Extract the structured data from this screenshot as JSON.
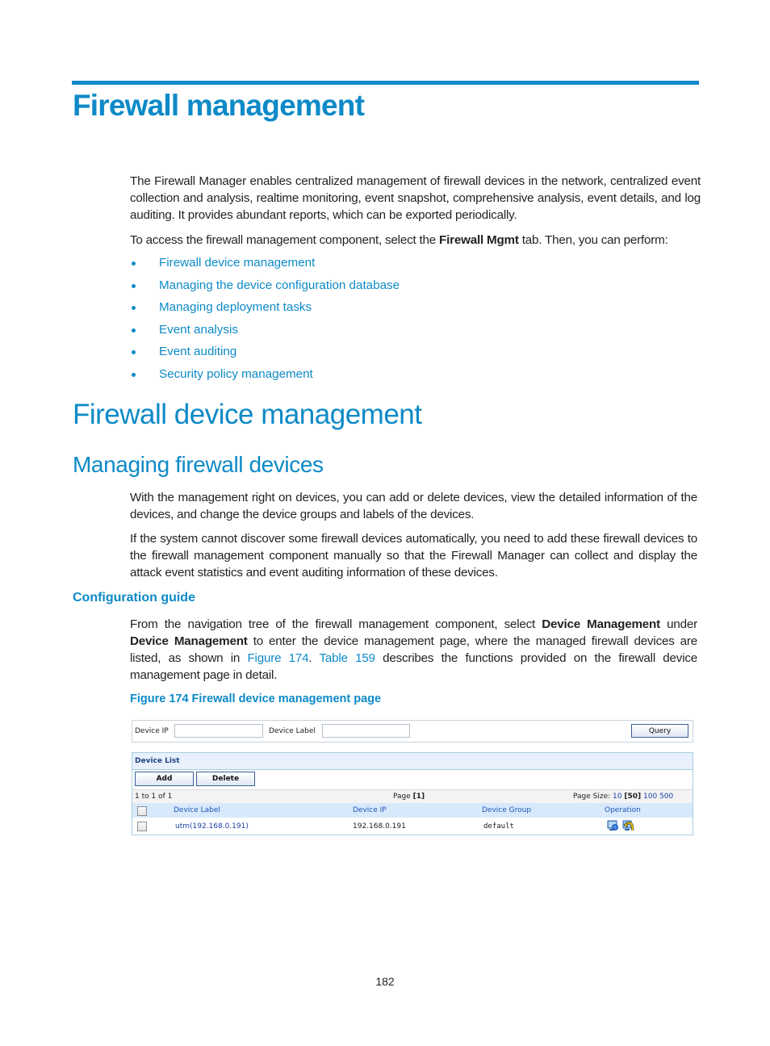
{
  "heading1": "Firewall management",
  "intro": {
    "para1": "The Firewall Manager enables centralized management of firewall devices in the network, centralized event collection and analysis, realtime monitoring, event snapshot, comprehensive analysis, event details, and log auditing. It provides abundant reports, which can be exported periodically.",
    "para2_before": "To access the firewall management component, select the ",
    "para2_bold": "Firewall Mgmt",
    "para2_after": " tab. Then, you can perform:"
  },
  "bullets": [
    "Firewall device management",
    "Managing the device configuration database",
    "Managing deployment tasks",
    "Event analysis",
    "Event auditing",
    "Security policy management"
  ],
  "heading2": "Firewall device management",
  "heading3": "Managing firewall devices",
  "section": {
    "para1": "With the management right on devices, you can add or delete devices, view the detailed information of the devices, and change the device groups and labels of the devices.",
    "para2": "If the system cannot discover some firewall devices automatically, you need to add these firewall devices to the firewall management component manually so that the Firewall Manager can collect and display the attack event statistics and event auditing information of these devices."
  },
  "heading4": "Configuration guide",
  "guide": {
    "t1": "From the navigation tree of the firewall management component, select ",
    "b1": "Device Management",
    "t2": " under ",
    "b2": "Device Management",
    "t3": " to enter the device management page, where the managed firewall devices are listed, as shown in ",
    "link1": "Figure 174",
    "t4": ". ",
    "link2": "Table 159",
    "t5": " describes the functions provided on the firewall device management page in detail."
  },
  "figure_caption": "Figure 174 Firewall device management page",
  "ui": {
    "device_ip_label": "Device IP",
    "device_ip_value": "",
    "device_label_label": "Device Label",
    "device_label_value": "",
    "query_button": "Query",
    "list_title": "Device List",
    "add_button": "Add",
    "delete_button": "Delete",
    "record_count": "1 to 1 of 1",
    "page_prefix": "Page ",
    "page_current": "[1]",
    "page_size_label": "Page Size: ",
    "page_sizes": [
      "10",
      "[50]",
      "100",
      "500"
    ],
    "columns": [
      "Device Label",
      "Device IP",
      "Device Group",
      "Operation"
    ],
    "rows": [
      {
        "label": "utm(192.168.0.191)",
        "ip": "192.168.0.191",
        "group": "default",
        "operations": [
          "device-detail-icon",
          "sync-config-icon"
        ]
      }
    ]
  },
  "page_number": "182",
  "colors": {
    "accent": "#0d8ac7",
    "body_text": "#231f20",
    "ui_link": "#1a3fa8",
    "ui_header_bg": "#d7e9fb"
  }
}
